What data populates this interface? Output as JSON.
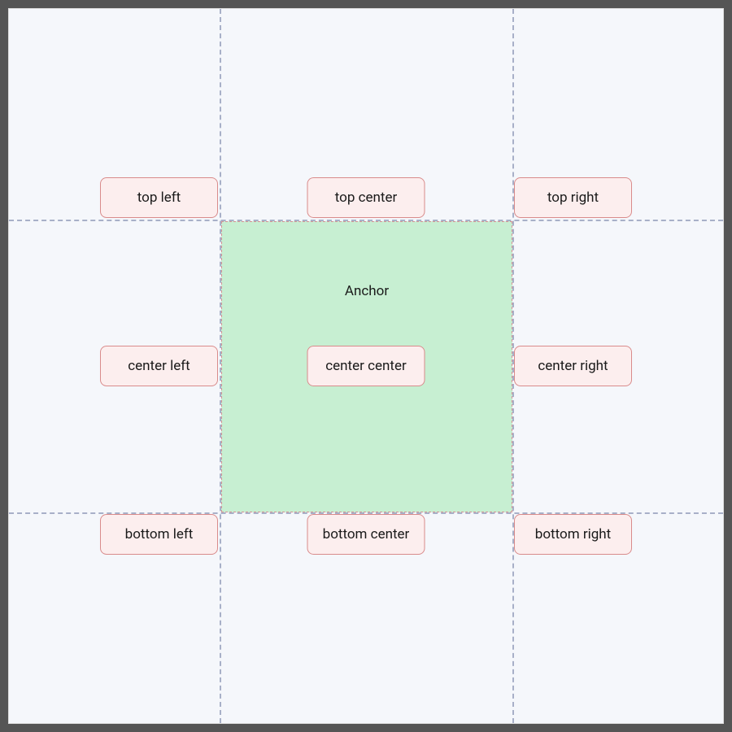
{
  "anchor": {
    "label": "Anchor"
  },
  "positions": {
    "top_left": "top left",
    "top_center": "top center",
    "top_right": "top right",
    "center_left": "center left",
    "center_center": "center center",
    "center_right": "center right",
    "bottom_left": "bottom left",
    "bottom_center": "bottom center",
    "bottom_right": "bottom right"
  }
}
